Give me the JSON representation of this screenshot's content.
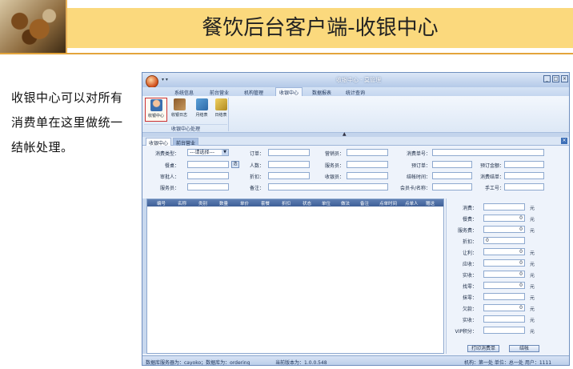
{
  "slide": {
    "title": "餐饮后台客户端-收银中心",
    "description": "收银中心可以对所有消费单在这里做统一结帐处理。"
  },
  "window": {
    "caption": "收银中心 - 莫管理",
    "menu": [
      "系统信息",
      "前台营业",
      "机构管理",
      "收银中心",
      "数据报表",
      "统计查询"
    ],
    "active_menu_index": 3,
    "ribbon_buttons": [
      "收银中心",
      "收银日志",
      "月结表",
      "日结表"
    ],
    "ribbon_group": "收银中心处理"
  },
  "tabs": [
    "收银中心",
    "前台营业"
  ],
  "form": {
    "consume_type_label": "消费类型：",
    "consume_type_value": "---请选择---",
    "table_label": "餐桌：",
    "pick_label": "选",
    "approver_label": "审批人：",
    "waiter_label": "服务员：",
    "order_label": "订单：",
    "people_label": "人数：",
    "discount_note_label": "折扣：",
    "remark_label": "备注：",
    "salesman_label": "营销员：",
    "service_label": "服务员：",
    "cashier_label": "收银员：",
    "consume_no_label": "消费单号：",
    "prepay_no_label": "预订单：",
    "prepay_amount_label": "预订金额：",
    "account_time_label": "结帐时间：",
    "consume_bill_label": "消费结单：",
    "member_card_label": "会员卡/名称：",
    "hand_no_label": "手工号："
  },
  "grid_columns": [
    "编号",
    "名称",
    "类别",
    "数量",
    "单价",
    "套餐",
    "折扣",
    "状态",
    "单位",
    "做法",
    "备注",
    "点单时间",
    "点单人",
    "赠送"
  ],
  "summary": [
    {
      "label": "消费：",
      "value": "",
      "unit": "元"
    },
    {
      "label": "餐费：",
      "value": "0",
      "unit": "元"
    },
    {
      "label": "服务费：",
      "value": "0",
      "unit": "元"
    },
    {
      "label": "折扣：",
      "value": "0",
      "unit": ""
    },
    {
      "label": "让利：",
      "value": "0",
      "unit": "元"
    },
    {
      "label": "应收：",
      "value": "0",
      "unit": "元"
    },
    {
      "label": "实收：",
      "value": "0",
      "unit": "元"
    },
    {
      "label": "找零：",
      "value": "0",
      "unit": "元"
    },
    {
      "label": "抹零：",
      "value": "",
      "unit": "元"
    },
    {
      "label": "欠款：",
      "value": "0",
      "unit": "元"
    },
    {
      "label": "实收：",
      "value": "",
      "unit": "元"
    },
    {
      "label": "VIP积分：",
      "value": "",
      "unit": "元"
    }
  ],
  "actions": {
    "print": "打印消费单",
    "settle": "结帐"
  },
  "status": {
    "server": "数据库服务器为：cayoko；数据库为：ordering",
    "version": "当前版本为：1.0.0.548",
    "right": "机构：第一处 单位：总一处 用户：1111"
  }
}
